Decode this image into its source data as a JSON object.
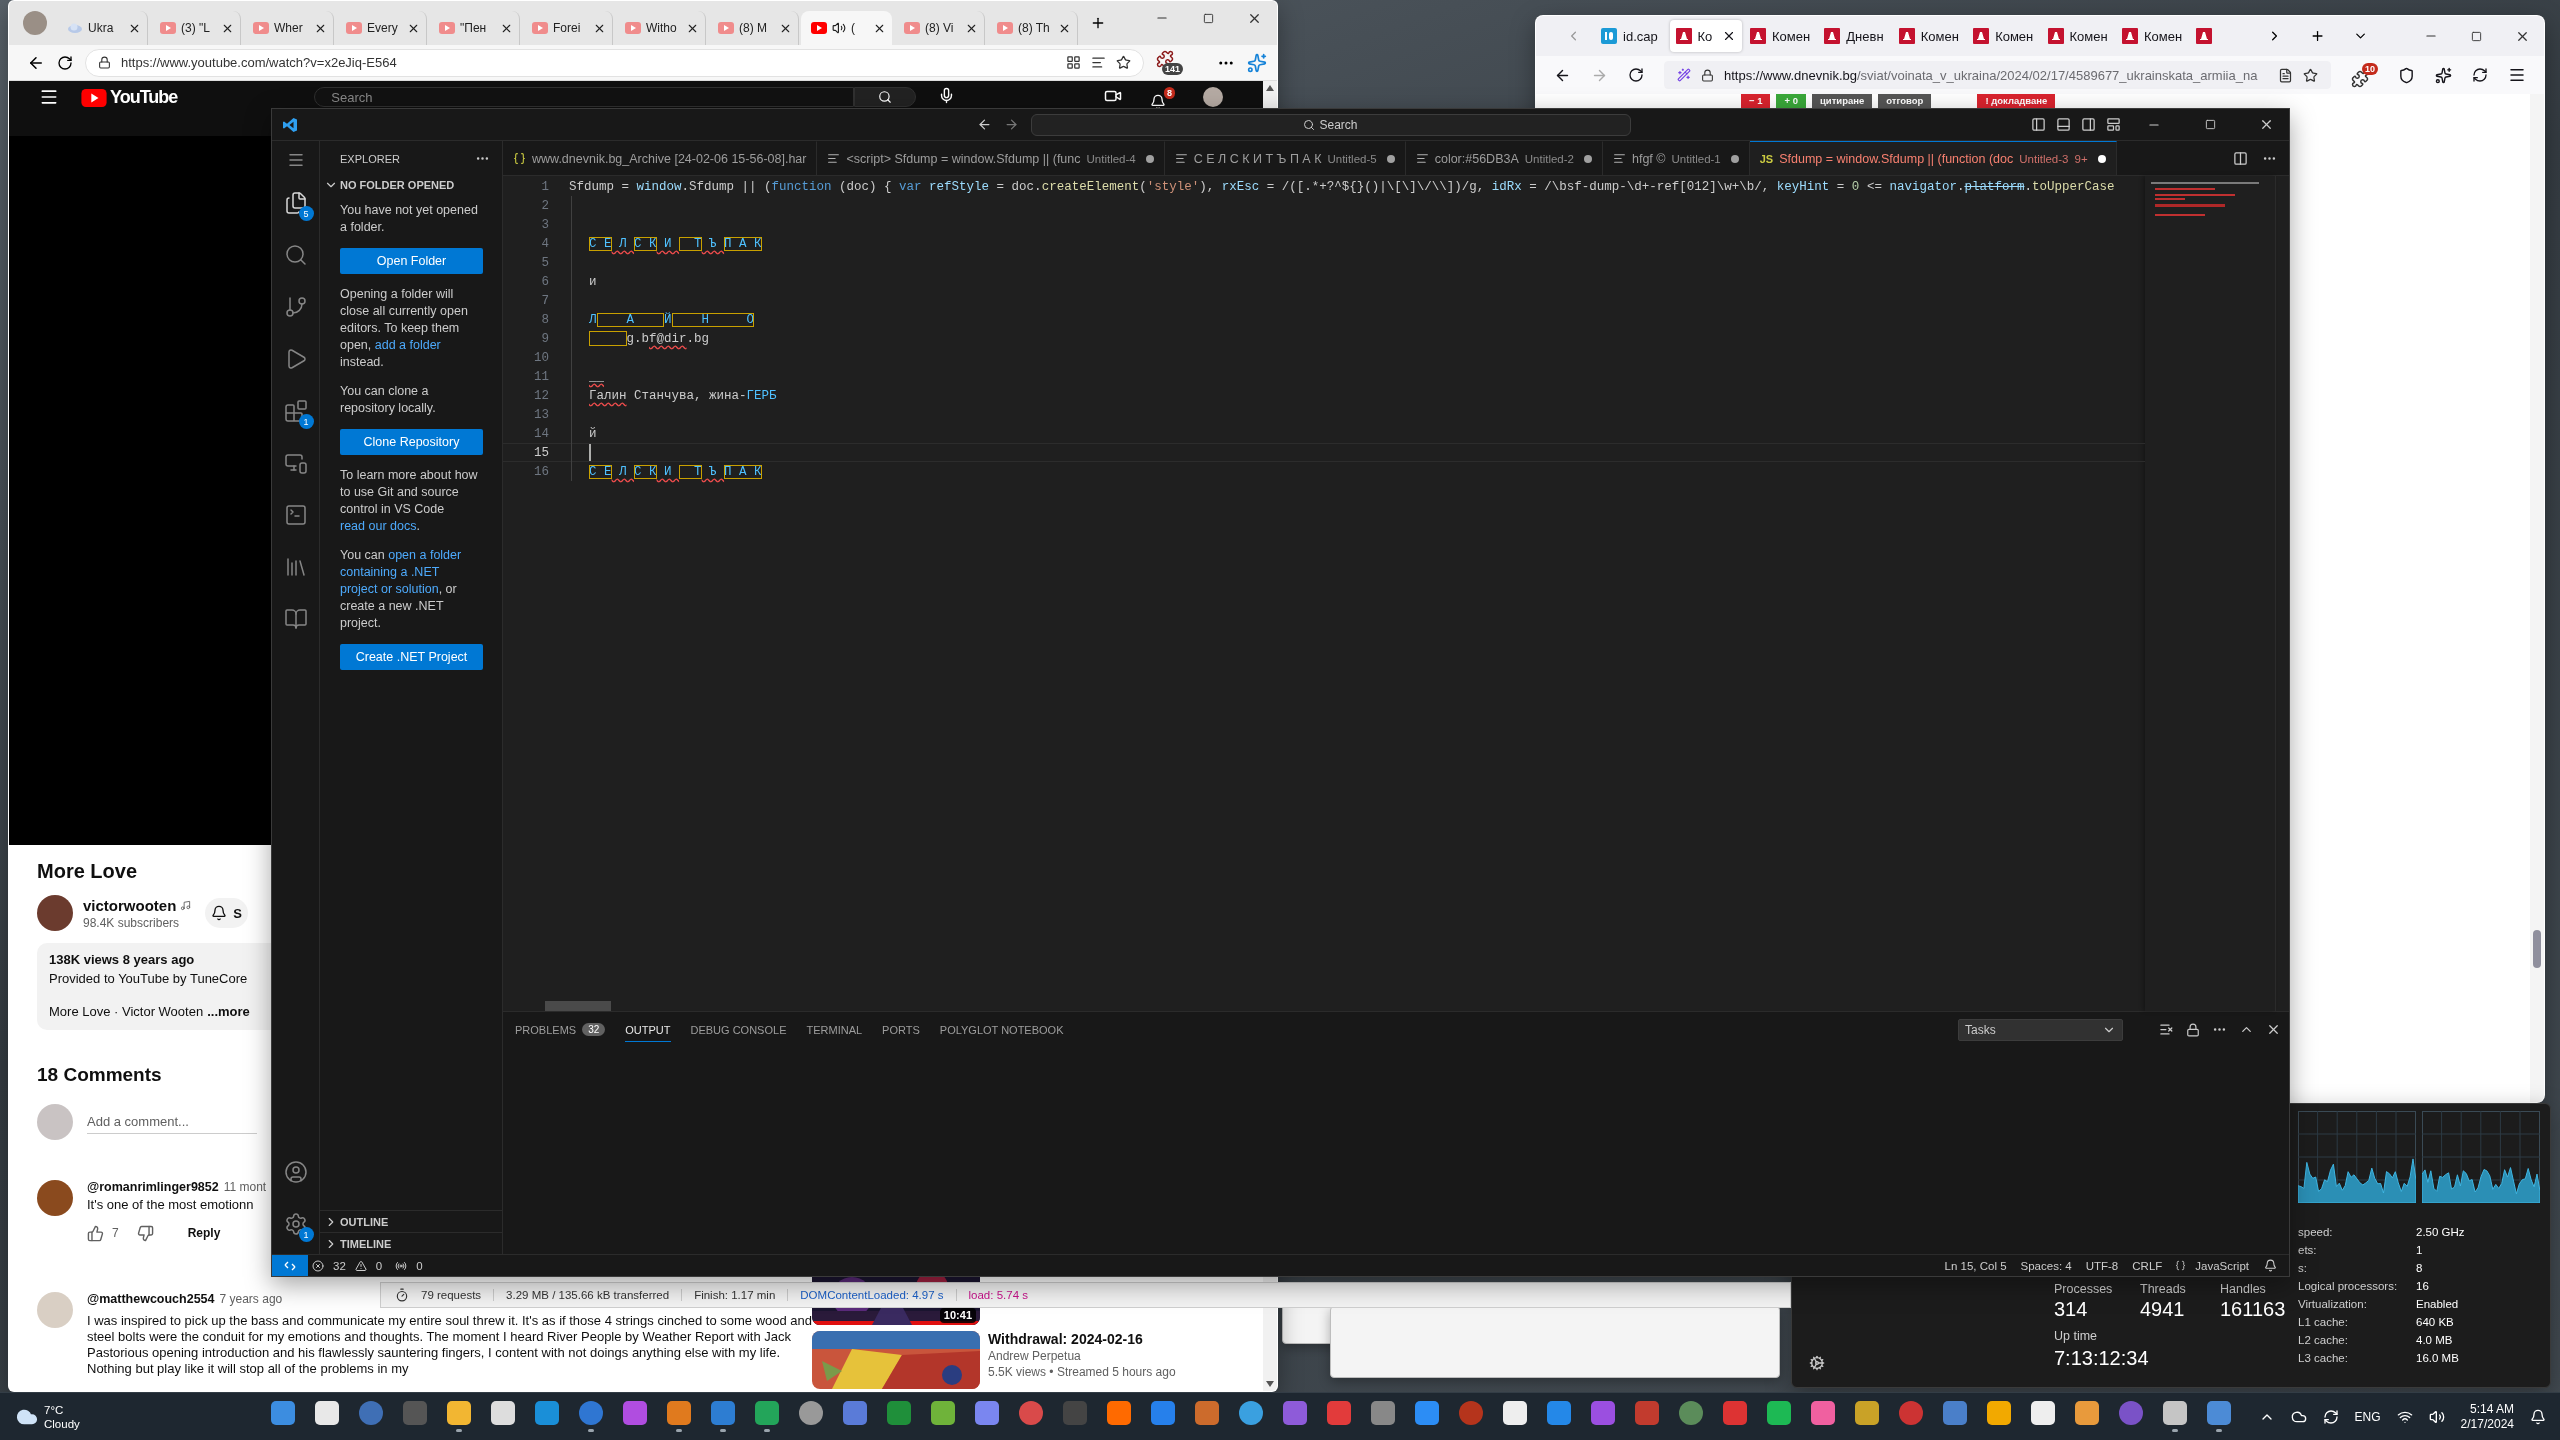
{
  "edge": {
    "tabs": [
      {
        "label": "Ukra",
        "kind": "web",
        "selected": false,
        "playing": false
      },
      {
        "label": "(3) \"L",
        "kind": "yt",
        "selected": false,
        "playing": false
      },
      {
        "label": "Wher",
        "kind": "yt",
        "selected": false,
        "playing": false
      },
      {
        "label": "Every",
        "kind": "yt",
        "selected": false,
        "playing": false
      },
      {
        "label": "\"Пен",
        "kind": "yt",
        "selected": false,
        "playing": false
      },
      {
        "label": "Forei",
        "kind": "yt",
        "selected": false,
        "playing": false
      },
      {
        "label": "Witho",
        "kind": "yt",
        "selected": false,
        "playing": false
      },
      {
        "label": "(8) M",
        "kind": "yt",
        "selected": false,
        "playing": false
      },
      {
        "label": "(",
        "kind": "yt",
        "selected": true,
        "playing": true
      },
      {
        "label": "(8) Vi",
        "kind": "yt",
        "selected": false,
        "playing": false
      },
      {
        "label": "(8) Th",
        "kind": "yt",
        "selected": false,
        "playing": false
      }
    ],
    "url": "https://www.youtube.com/watch?v=x2eJiq-E564",
    "extension_badge": "141",
    "youtube": {
      "logo": "YouTube",
      "search_placeholder": "Search",
      "notifications": "8",
      "title": "More Love",
      "channel": "victorwooten",
      "subscribers": "98.4K subscribers",
      "subscribe_label": "S",
      "stats": "138K views  8 years ago",
      "description": "Provided to YouTube by TuneCore",
      "description_more": "More Love · Victor Wooten",
      "more": "...more",
      "comments_heading": "18 Comments",
      "comment_placeholder": "Add a comment...",
      "comments": [
        {
          "author": "@romanrimlinger9852",
          "time": "11 mont",
          "text": "It's one of the most emotionn",
          "likes": "7",
          "reply": "Reply"
        },
        {
          "author": "@matthewcouch2554",
          "time": "7 years ago",
          "text": "I was inspired to pick up the bass and communicate my entire soul threw it. It's as if those 4 strings cinched to some wood and steel bolts were the conduit for my emotions and thoughts. The moment I heard River People by Weather Report with Jack Pastorious opening introduction and his flawlessly sauntering fingers, I content with not doings anything else with my life. Nothing but play like it will stop all of the problems in my"
        }
      ],
      "recommended": [
        {
          "duration": "10:41"
        },
        {
          "title": "Withdrawal: 2024-02-16",
          "channel": "Andrew Perpetua",
          "meta": "5.5K views • Streamed 5 hours ago"
        }
      ]
    }
  },
  "firefox": {
    "tabs": [
      {
        "label": "id.cap",
        "kind": "id",
        "selected": false
      },
      {
        "label": "Ко",
        "kind": "d",
        "selected": true
      },
      {
        "label": "Комен",
        "kind": "d",
        "selected": false
      },
      {
        "label": "Дневн",
        "kind": "d",
        "selected": false
      },
      {
        "label": "Комен",
        "kind": "d",
        "selected": false
      },
      {
        "label": "Комен",
        "kind": "d",
        "selected": false
      },
      {
        "label": "Комен",
        "kind": "d",
        "selected": false
      },
      {
        "label": "Комен",
        "kind": "d",
        "selected": false
      },
      {
        "kind": "d",
        "selected": false
      }
    ],
    "url_host": "https://www.dnevnik.bg",
    "url_path": "/sviat/voinata_v_ukraina/2024/02/17/4589677_ukrainskata_armiia_na",
    "extension_badge": "10",
    "comment_actions": [
      {
        "text": "− 1",
        "kind": "down"
      },
      {
        "text": "+ 0",
        "kind": "up"
      },
      {
        "text": "цитиране",
        "kind": "neutral"
      },
      {
        "text": "отговор",
        "kind": "neutral"
      },
      {
        "text": "! докладване",
        "kind": "report"
      }
    ]
  },
  "vscode": {
    "search": "Search",
    "activity": [
      {
        "kind": "explorer",
        "badge": "5"
      },
      {
        "kind": "search"
      },
      {
        "kind": "git"
      },
      {
        "kind": "run"
      },
      {
        "kind": "extensions",
        "badge": "1"
      },
      {
        "kind": "remote"
      },
      {
        "kind": "terminal"
      },
      {
        "kind": "pages"
      },
      {
        "kind": "book"
      }
    ],
    "manage_badge": "1",
    "sidebar": {
      "title": "EXPLORER",
      "section": "NO FOLDER OPENED",
      "blocks": [
        {
          "kind": "text",
          "segments": [
            {
              "text": "You have not yet opened a folder.",
              "link": false
            }
          ]
        },
        {
          "kind": "button",
          "label": "Open Folder"
        },
        {
          "kind": "text",
          "segments": [
            {
              "text": "Opening a folder will close all currently open editors. To keep them open, ",
              "link": false
            },
            {
              "text": "add a folder",
              "link": true
            },
            {
              "text": " instead.",
              "link": false
            }
          ]
        },
        {
          "kind": "text",
          "segments": [
            {
              "text": "You can clone a repository locally.",
              "link": false
            }
          ]
        },
        {
          "kind": "button",
          "label": "Clone Repository"
        },
        {
          "kind": "text",
          "segments": [
            {
              "text": "To learn more about how to use Git and source control in VS Code ",
              "link": false
            },
            {
              "text": "read our docs",
              "link": true
            },
            {
              "text": ".",
              "link": false
            }
          ]
        },
        {
          "kind": "text",
          "segments": [
            {
              "text": "You can ",
              "link": false
            },
            {
              "text": "open a folder",
              "link": true
            },
            {
              "text": "containing a .NET",
              "link": true
            },
            {
              "text": "project or solution",
              "link": true
            },
            {
              "text": ", or create a new .NET project.",
              "link": false
            }
          ]
        },
        {
          "kind": "button",
          "label": "Create .NET Project"
        }
      ],
      "footer_sections": [
        "OUTLINE",
        "TIMELINE"
      ]
    },
    "tabs": [
      {
        "kind": "json",
        "title": "www.dnevnik.bg_Archive [24-02-06 15-56-08].har",
        "selected": false,
        "dirty": false,
        "errors": false
      },
      {
        "kind": "text",
        "title": "<script> Sfdump = window.Sfdump || (func",
        "detail": "Untitled-4",
        "selected": false,
        "dirty": true,
        "errors": false
      },
      {
        "kind": "text",
        "title": "С Е Л С К И Т Ъ П А К",
        "detail": "Untitled-5",
        "selected": false,
        "dirty": true,
        "errors": false
      },
      {
        "kind": "text",
        "title": "color:#56DB3A",
        "detail": "Untitled-2",
        "selected": false,
        "dirty": true,
        "errors": false
      },
      {
        "kind": "text",
        "title": "hfgf ©",
        "detail": "Untitled-1",
        "selected": false,
        "dirty": true,
        "errors": false
      },
      {
        "kind": "js",
        "file_type": "JS",
        "title": "Sfdump = window.Sfdump || (function (doc",
        "detail": "Untitled-3",
        "problems": "9+",
        "selected": true,
        "dirty": true,
        "errors": true
      }
    ],
    "lines": [
      {
        "number": "1",
        "indented": false,
        "current": false,
        "leading_box": false,
        "segments": [
          {
            "text": "Sfdump = ",
            "kind": "plain",
            "error": false
          },
          {
            "text": "window",
            "kind": "var",
            "error": false
          },
          {
            "text": ".Sfdump || (",
            "kind": "plain",
            "error": false
          },
          {
            "text": "function",
            "kind": "kw",
            "error": false
          },
          {
            "text": " (doc) { ",
            "kind": "plain",
            "error": false
          },
          {
            "text": "var",
            "kind": "kw",
            "error": false
          },
          {
            "text": " refStyle",
            "kind": "var",
            "error": false
          },
          {
            "text": " = doc.",
            "kind": "plain",
            "error": false
          },
          {
            "text": "createElement",
            "kind": "fn",
            "error": false
          },
          {
            "text": "(",
            "kind": "plain",
            "error": false
          },
          {
            "text": "'style'",
            "kind": "str",
            "error": false
          },
          {
            "text": "), ",
            "kind": "plain",
            "error": false
          },
          {
            "text": "rxEsc",
            "kind": "var",
            "error": false
          },
          {
            "text": " = /([.*+?^${}()|\\[\\]\\/\\\\])/g, ",
            "kind": "plain",
            "error": false
          },
          {
            "text": "idRx",
            "kind": "var",
            "error": false
          },
          {
            "text": " = /\\bsf-dump-\\d+-ref[012]\\w+\\b/, ",
            "kind": "plain",
            "error": false
          },
          {
            "text": "keyHint",
            "kind": "var",
            "error": false
          },
          {
            "text": " = ",
            "kind": "plain",
            "error": false
          },
          {
            "text": "0",
            "kind": "num",
            "error": false
          },
          {
            "text": " <= ",
            "kind": "plain",
            "error": false
          },
          {
            "text": "navigator",
            "kind": "var",
            "error": false
          },
          {
            "text": ".",
            "kind": "plain",
            "error": false
          },
          {
            "text": "platform",
            "kind": "deprecated",
            "error": false
          },
          {
            "text": ".",
            "kind": "plain",
            "error": false
          },
          {
            "text": "toUpperCase",
            "kind": "fn",
            "error": false
          }
        ]
      },
      {
        "number": "2",
        "indented": true,
        "current": false,
        "leading_box": false
      },
      {
        "number": "3",
        "indented": true,
        "current": false,
        "leading_box": false
      },
      {
        "number": "4",
        "indented": true,
        "current": false,
        "leading_box": false,
        "segments": [
          {
            "text": "С Е",
            "kind": "boxed",
            "error": false
          },
          {
            "text": " Л ",
            "kind": "ident",
            "error": true
          },
          {
            "text": "С К",
            "kind": "boxed",
            "error": false
          },
          {
            "text": " И ",
            "kind": "ident",
            "error": true
          },
          {
            "text": "  Т",
            "kind": "boxed",
            "error": false
          },
          {
            "text": " Ъ ",
            "kind": "ident",
            "error": true
          },
          {
            "text": "П А К",
            "kind": "boxed",
            "error": false
          }
        ]
      },
      {
        "number": "5",
        "indented": true,
        "current": false,
        "leading_box": false
      },
      {
        "number": "6",
        "indented": true,
        "current": false,
        "leading_box": false,
        "segments": [
          {
            "text": "и",
            "kind": "plain",
            "error": false
          }
        ]
      },
      {
        "number": "7",
        "indented": true,
        "current": false,
        "leading_box": false
      },
      {
        "number": "8",
        "indented": true,
        "current": false,
        "leading_box": false,
        "segments": [
          {
            "text": "Л",
            "kind": "ident",
            "error": false
          },
          {
            "text": "    А    ",
            "kind": "boxed",
            "error": false
          },
          {
            "text": "Й",
            "kind": "ident",
            "error": false
          },
          {
            "text": "    Н     О",
            "kind": "boxed",
            "error": false
          }
        ]
      },
      {
        "number": "9",
        "indented": true,
        "current": false,
        "leading_box": true,
        "segments": [
          {
            "text": "g.b",
            "kind": "plain",
            "error": false
          },
          {
            "text": "f@dir",
            "kind": "plain",
            "error": true
          },
          {
            "text": ".bg",
            "kind": "plain",
            "error": false
          }
        ]
      },
      {
        "number": "10",
        "indented": true,
        "current": false,
        "leading_box": false
      },
      {
        "number": "11",
        "indented": true,
        "current": false,
        "leading_box": false,
        "segments": [
          {
            "text": "__",
            "kind": "plain",
            "error": true
          }
        ]
      },
      {
        "number": "12",
        "indented": true,
        "current": false,
        "leading_box": false,
        "segments": [
          {
            "text": "Галин",
            "kind": "plain",
            "error": true
          },
          {
            "text": " Станчува, жина-",
            "kind": "plain",
            "error": false
          },
          {
            "text": "ГЕРБ",
            "kind": "ident",
            "error": false
          }
        ]
      },
      {
        "number": "13",
        "indented": true,
        "current": false,
        "leading_box": false
      },
      {
        "number": "14",
        "indented": true,
        "current": false,
        "leading_box": false,
        "segments": [
          {
            "text": "й",
            "kind": "plain",
            "error": false
          }
        ]
      },
      {
        "number": "15",
        "indented": true,
        "current": true,
        "leading_box": false
      },
      {
        "number": "16",
        "indented": true,
        "current": false,
        "leading_box": false,
        "segments": [
          {
            "text": "С Е",
            "kind": "boxed",
            "error": false
          },
          {
            "text": " Л ",
            "kind": "ident",
            "error": true
          },
          {
            "text": "С К",
            "kind": "boxed",
            "error": false
          },
          {
            "text": " И ",
            "kind": "ident",
            "error": true
          },
          {
            "text": "  Т",
            "kind": "boxed",
            "error": false
          },
          {
            "text": " Ъ ",
            "kind": "ident",
            "error": true
          },
          {
            "text": "П А К",
            "kind": "boxed",
            "error": false
          }
        ]
      }
    ],
    "panel_tabs": [
      {
        "label": "PROBLEMS",
        "badge": "32",
        "selected": false
      },
      {
        "label": "OUTPUT",
        "selected": true
      },
      {
        "label": "DEBUG CONSOLE",
        "selected": false
      },
      {
        "label": "TERMINAL",
        "selected": false
      },
      {
        "label": "PORTS",
        "selected": false
      },
      {
        "label": "POLYGLOT NOTEBOOK",
        "selected": false
      }
    ],
    "output_channel": "Tasks",
    "status": {
      "errors": "32",
      "warnings": "0",
      "ports": "0",
      "right": [
        "Ln 15, Col 5",
        "Spaces: 4",
        "UTF-8",
        "CRLF"
      ],
      "language": "JavaScript"
    }
  },
  "devtools": {
    "items": [
      {
        "text": "79 requests",
        "kind": "plain"
      },
      {
        "text": "3.29 MB / 135.66 kB transferred",
        "kind": "plain"
      },
      {
        "text": "Finish: 1.17 min",
        "kind": "plain"
      },
      {
        "text": "DOMContentLoaded: 4.97 s",
        "kind": "dom"
      },
      {
        "text": "load: 5.74 s",
        "kind": "load"
      }
    ]
  },
  "task_manager": {
    "stats": [
      {
        "label": "Processes",
        "value": "314"
      },
      {
        "label": "Threads",
        "value": "4941"
      },
      {
        "label": "Handles",
        "value": "161163"
      }
    ],
    "uptime": {
      "label": "Up time",
      "value": "7:13:12:34"
    },
    "specs": [
      {
        "label": "speed:",
        "value": "2.50 GHz"
      },
      {
        "label": "ets:",
        "value": "1"
      },
      {
        "label": "s:",
        "value": "8"
      },
      {
        "label": "Logical processors:",
        "value": "16"
      },
      {
        "label": "Virtualization:",
        "value": "Enabled"
      },
      {
        "label": "L1 cache:",
        "value": "640 KB"
      },
      {
        "label": "L2 cache:",
        "value": "4.0 MB"
      },
      {
        "label": "L3 cache:",
        "value": "16.0 MB"
      }
    ]
  },
  "taskbar": {
    "weather": {
      "temp": "7°C",
      "condition": "Cloudy"
    },
    "apps": [
      {
        "open": false
      },
      {
        "open": false
      },
      {
        "open": false
      },
      {
        "open": false
      },
      {
        "open": true
      },
      {
        "open": false
      },
      {
        "open": false
      },
      {
        "open": true
      },
      {
        "open": false
      },
      {
        "open": true
      },
      {
        "open": true
      },
      {
        "open": true
      },
      {
        "open": false
      },
      {
        "open": false
      },
      {
        "open": false
      },
      {
        "open": false
      },
      {
        "open": false
      },
      {
        "open": false
      },
      {
        "open": false
      },
      {
        "open": false
      },
      {
        "open": false
      },
      {
        "open": false
      },
      {
        "open": false
      },
      {
        "open": false
      },
      {
        "open": false
      },
      {
        "open": false
      },
      {
        "open": false
      },
      {
        "open": false
      },
      {
        "open": false
      },
      {
        "open": false
      },
      {
        "open": false
      },
      {
        "open": false
      },
      {
        "open": false
      },
      {
        "open": false
      },
      {
        "open": false
      },
      {
        "open": false
      },
      {
        "open": false
      },
      {
        "open": false
      },
      {
        "open": false
      },
      {
        "open": false
      },
      {
        "open": false
      },
      {
        "open": false
      },
      {
        "open": false
      },
      {
        "open": true
      },
      {
        "open": true
      }
    ],
    "language": "ENG",
    "time": "5:14 AM",
    "date": "2/17/2024"
  }
}
